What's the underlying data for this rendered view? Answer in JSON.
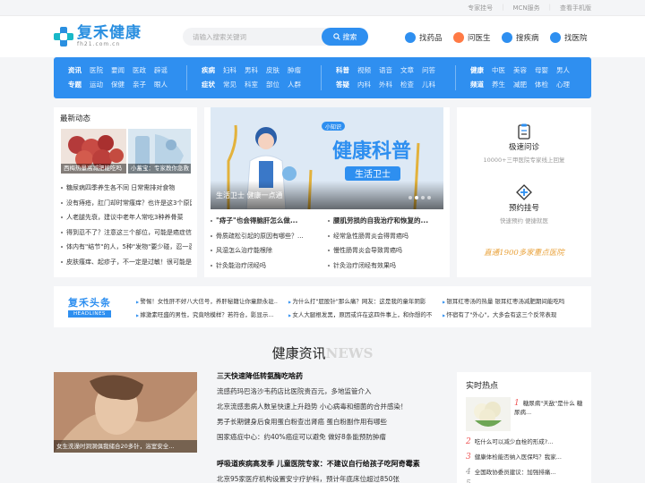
{
  "topbar": {
    "links": [
      "专家挂号",
      "MCN服务",
      "查看手机版"
    ]
  },
  "logo": {
    "name": "复禾健康",
    "url": "fh21.com.cn"
  },
  "search": {
    "placeholder": "请输入搜索关键词",
    "button": "搜索"
  },
  "quick_links": [
    {
      "label": "找药品",
      "icon": "pill-icon",
      "color": "#2e8ff0"
    },
    {
      "label": "问医生",
      "icon": "doctor-icon",
      "color": "#ff7a45"
    },
    {
      "label": "搜疾病",
      "icon": "disease-icon",
      "color": "#2e8ff0"
    },
    {
      "label": "找医院",
      "icon": "hospital-icon",
      "color": "#2e8ff0"
    }
  ],
  "nav": {
    "groups": [
      {
        "rows": [
          [
            "资讯",
            "医院",
            "要闻",
            "医政",
            "辟谣"
          ],
          [
            "专题",
            "运动",
            "保健",
            "亲子",
            "眼人"
          ]
        ]
      },
      {
        "rows": [
          [
            "疾病",
            "妇科",
            "男科",
            "皮肤",
            "肿瘤"
          ],
          [
            "症状",
            "常见",
            "科室",
            "部位",
            "人群"
          ]
        ]
      },
      {
        "rows": [
          [
            "科普",
            "视频",
            "语音",
            "文章",
            "问答"
          ],
          [
            "答疑",
            "内科",
            "外科",
            "检查",
            "儿科"
          ]
        ]
      },
      {
        "rows": [
          [
            "健康",
            "中医",
            "美容",
            "母婴",
            "男人"
          ],
          [
            "频道",
            "养生",
            "减肥",
            "体检",
            "心理"
          ]
        ]
      }
    ]
  },
  "latest": {
    "title": "最新动态",
    "thumbs": [
      {
        "caption": "西梅热量高减肥能吃吗",
        "icon": "fruit-image"
      },
      {
        "caption": "小蓄宝：专家教你急救",
        "icon": "water-bottle-image"
      }
    ],
    "items": [
      "糖尿病四季养生各不同 日常需排对食物",
      "没有痔疮，肛门却时常瘙痒？也许是这3个原因",
      "人老腿先衰，建议中老年人常吃3种养骨菜",
      "得到忍不了？注意这三个部位，可能是癌症信号",
      "体内有\"结节\"的人，5种\"发物\"要少碰，忍一忍",
      "皮肤瘙痒、起疹子，不一定是过敏！很可能是病"
    ]
  },
  "banner": {
    "caption": "生活卫士 健康一点通",
    "headline": "健康科普",
    "ribbon": "生活卫士",
    "tag": "小知识",
    "dots": 4,
    "active_dot": 2
  },
  "center_lists": {
    "left": {
      "title": "\"痔子\"也会得脑肝怎么做...",
      "items": [
        "骨质疏松引起的原因有哪些？...",
        "风湿怎么治疗能根除",
        "针灸能治疗闭经吗"
      ]
    },
    "right": {
      "title": "腰肌劳损的自我治疗和恢复的...",
      "items": [
        "经常急性肠胃炎会得胃癌吗",
        "慢性肠胃炎会导致胃癌吗",
        "针灸治疗闭经有效果吗"
      ]
    }
  },
  "services": [
    {
      "title": "极速问诊",
      "sub": "10000+三甲医院专家线上回复",
      "icon": "consult-icon"
    },
    {
      "title": "预约挂号",
      "sub": "快速预约  便捷就医",
      "icon": "register-icon"
    }
  ],
  "slogan": "直通1900多家重点医院",
  "headlines": {
    "brand": "复禾头条",
    "brand_en": "HEADLINES",
    "items": [
      "警惕！女性肝不好八大信号，养肝秘籍让你童颜永驻...",
      "为什么打\"屁股针\"那么痛？网友：这是我的童年阴影",
      "银耳红枣汤的热量 银耳红枣汤减肥期间能吃吗",
      "嫁激素旺盛的男性，究竟啥模样？若符合，影显示...",
      "女人大腿根发黑，原因或许在这四件事上，和你想的不一...",
      "怀宿有了\"外心\"，大多会有这三个反常表现"
    ]
  },
  "news_section": {
    "cn": "健康资讯",
    "en": "NEWS"
  },
  "news": {
    "thumbs": [
      {
        "caption": "女生洗澡时洞洞俱我储合20多针，浴室安全...",
        "icon": "bath-image"
      }
    ],
    "group1": {
      "title": "三天快速降低转氨酶吃啥药",
      "items": [
        "流感药玛巴洛沙韦药店比医院贵百元，多地监管介入",
        "北京流感患病人数呈快速上升趋势 小心病毒和细菌的合并感染！",
        "男子长期健身后食用蛋白粉查出肾癌 蛋白粉副作用有哪些",
        "国家癌症中心：约40%癌症可以避免 做好8条能预防肿瘤"
      ]
    },
    "group2": {
      "title": "呼吸道疾病高发季 儿童医院专家：不建议自行给孩子吃阿奇霉素",
      "items": [
        "北京95家医疗机构设置安宁疗护科，预计年底床位超过850张"
      ]
    }
  },
  "hot": {
    "title": "实时热点",
    "items": [
      {
        "num": "1",
        "text": "糖尿病\"天敌\"是什么 糖尿病..."
      },
      {
        "num": "2",
        "text": "吃什么可以减少血栓的形成?..."
      },
      {
        "num": "3",
        "text": "健康体检能否纳入医保吗？我家..."
      },
      {
        "num": "4",
        "text": "全国政协委员建议：加强排痛..."
      },
      {
        "num": "5",
        "text": "..."
      }
    ]
  }
}
